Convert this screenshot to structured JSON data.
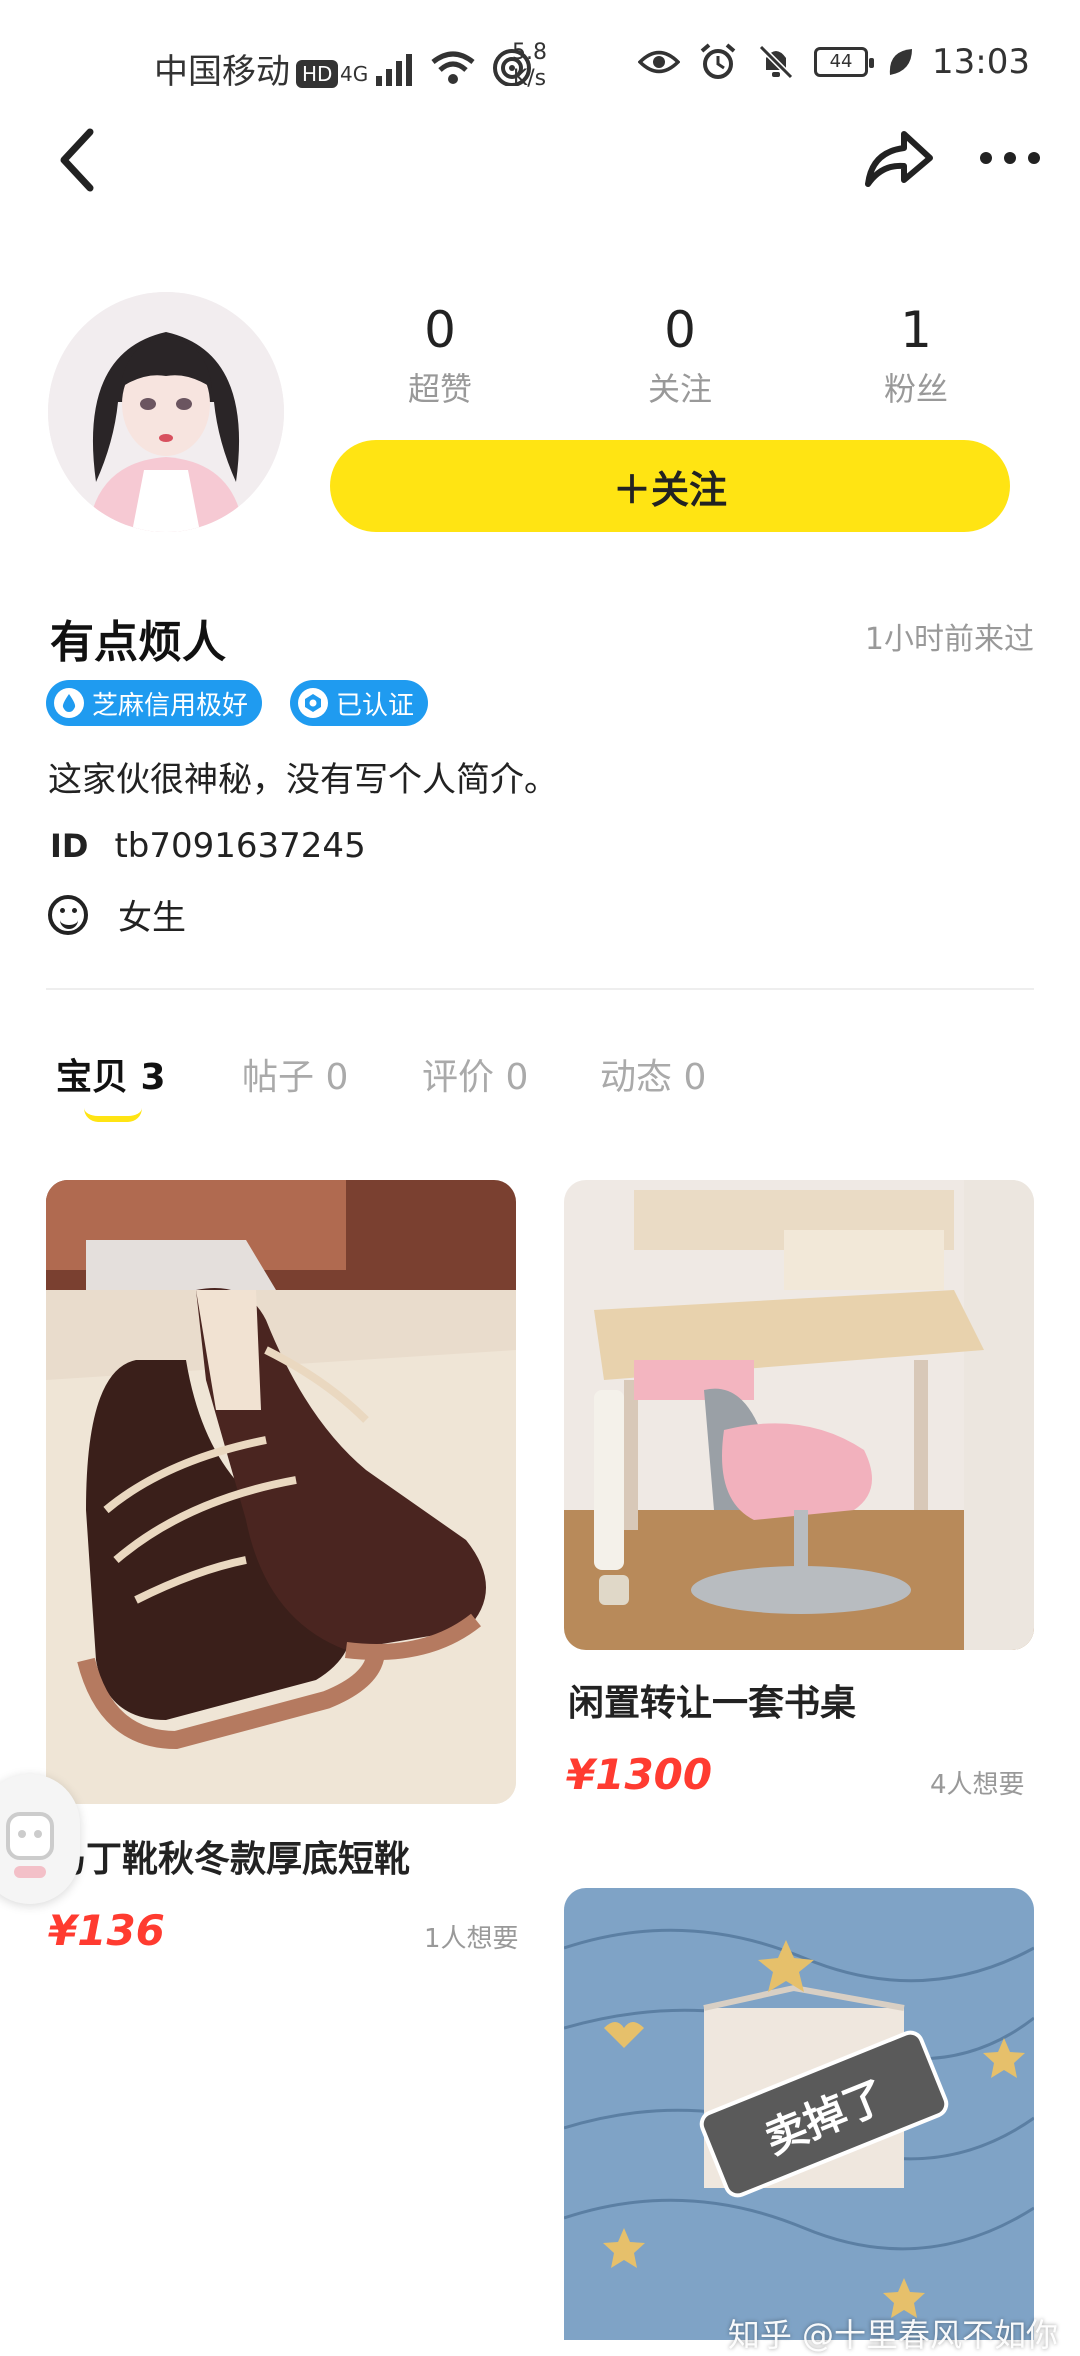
{
  "status_bar": {
    "carrier": "中国移动",
    "hd_badge": "HD",
    "network": "4G",
    "speed_value": "5.8",
    "speed_unit": "K/s",
    "battery": "44",
    "time": "13:03"
  },
  "nav": {
    "back_icon": "chevron-left-icon",
    "share_icon": "share-icon",
    "more_icon": "more-icon"
  },
  "profile": {
    "stats": [
      {
        "value": "0",
        "label": "超赞"
      },
      {
        "value": "0",
        "label": "关注"
      },
      {
        "value": "1",
        "label": "粉丝"
      }
    ],
    "follow_label": "＋关注",
    "username": "有点烦人",
    "last_seen": "1小时前来过",
    "tags": [
      {
        "icon": "drop-icon",
        "label": "芝麻信用极好"
      },
      {
        "icon": "verified-icon",
        "label": "已认证"
      }
    ],
    "bio": "这家伙很神秘，没有写个人简介。",
    "id_label": "ID",
    "id_value": "tb7091637245",
    "gender": "女生"
  },
  "tabs": [
    {
      "label": "宝贝 3",
      "active": true
    },
    {
      "label": "帖子 0",
      "active": false
    },
    {
      "label": "评价 0",
      "active": false
    },
    {
      "label": "动态 0",
      "active": false
    }
  ],
  "items": [
    {
      "title": "马丁靴秋冬款厚底短靴",
      "price": "¥136",
      "want": "1人想要"
    },
    {
      "title": "闲置转让一套书桌",
      "price": "¥1300",
      "want": "4人想要"
    },
    {
      "sold_label": "卖掉了"
    }
  ],
  "watermark": "知乎 @十里春风不如你",
  "colors": {
    "accent_yellow": "#ffe413",
    "tag_blue": "#1f9bf0",
    "price_red": "#ff3b30"
  }
}
